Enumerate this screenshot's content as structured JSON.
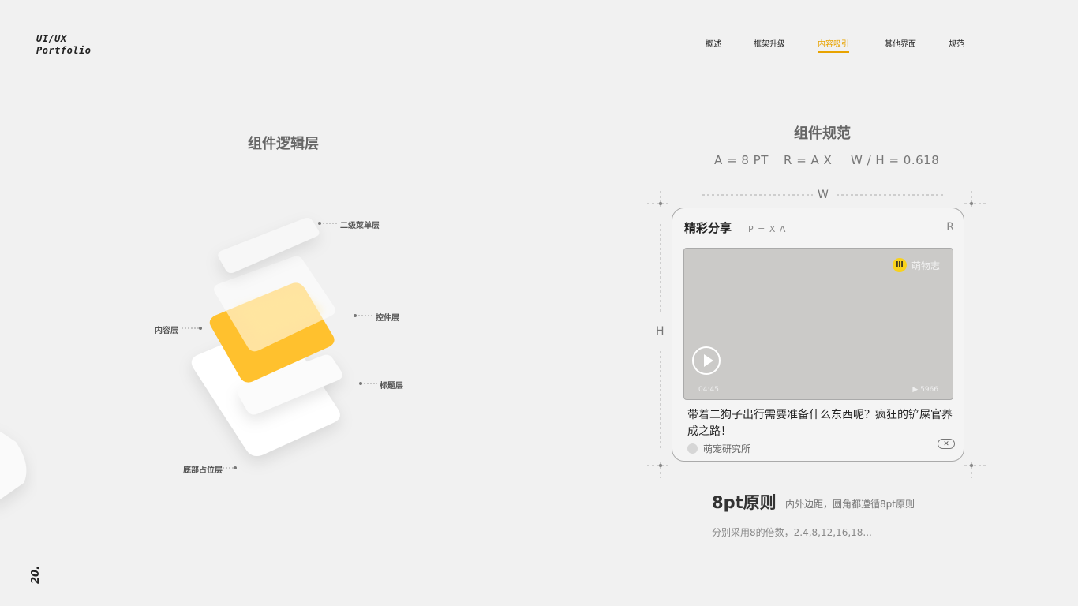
{
  "brand": {
    "line1": "UI/UX",
    "line2": "Portfolio"
  },
  "nav": {
    "items": [
      "概述",
      "框架升级",
      "内容吸引",
      "其他界面",
      "规范"
    ],
    "active_index": 2,
    "active_color": "#e8a300"
  },
  "page_number": "20.",
  "left_section": {
    "title": "组件逻辑层",
    "labels": {
      "menu": "二级菜单层",
      "control": "控件层",
      "content": "内容层",
      "title_layer": "标题层",
      "bottom": "底部占位层"
    },
    "accent_color": "#ffc12e"
  },
  "right_section": {
    "title": "组件规范",
    "spec": {
      "a": "A = 8 PT",
      "r": "R = A X",
      "ratio": "W / H = 0.618"
    },
    "dims": {
      "w": "W",
      "h": "H"
    },
    "card": {
      "title": "精彩分享",
      "padding_label": "P = X A",
      "radius_label": "R",
      "brand_name": "萌物志",
      "brand_icon": "lll",
      "duration": "04:45",
      "views": "▶ 5966",
      "description": "带着二狗子出行需要准备什么东西呢？疯狂的铲屎官养成之路！",
      "author": "萌宠研究所",
      "close_icon": "✕"
    },
    "principle": {
      "title": "8pt原则",
      "subtitle": "内外边距，圆角都遵循8pt原则",
      "note": "分别采用8的倍数，2.4,8,12,16,18..."
    }
  }
}
